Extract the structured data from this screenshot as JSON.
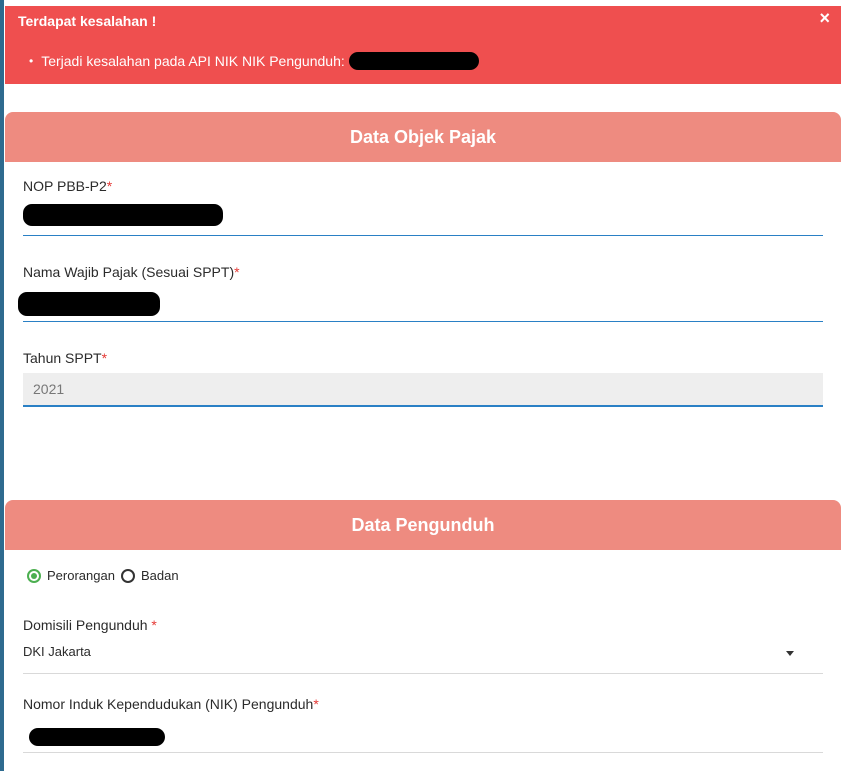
{
  "alert": {
    "title": "Terdapat kesalahan !",
    "close_symbol": "×",
    "items": [
      {
        "text": "Terjadi kesalahan pada API NIK NIK Pengunduh:"
      }
    ]
  },
  "section_objek": {
    "title": "Data Objek Pajak",
    "nop_label": "NOP PBB-P2",
    "nama_label": "Nama Wajib Pajak (Sesuai SPPT)",
    "tahun_label": "Tahun SPPT",
    "tahun_value": "2021"
  },
  "section_pengunduh": {
    "title": "Data Pengunduh",
    "radio_options": [
      "Perorangan",
      "Badan"
    ],
    "radio_selected": "Perorangan",
    "domisili_label": "Domisili Pengunduh",
    "domisili_value": "DKI Jakarta",
    "nik_label": "Nomor Induk Kependudukan (NIK) Pengunduh"
  },
  "required_mark": "*",
  "colors": {
    "alert_bg": "#ef4f4f",
    "section_header_bg": "#ee8b80",
    "focus_line": "#2a80c5",
    "radio_checked": "#4caf50",
    "required": "#e53935"
  }
}
